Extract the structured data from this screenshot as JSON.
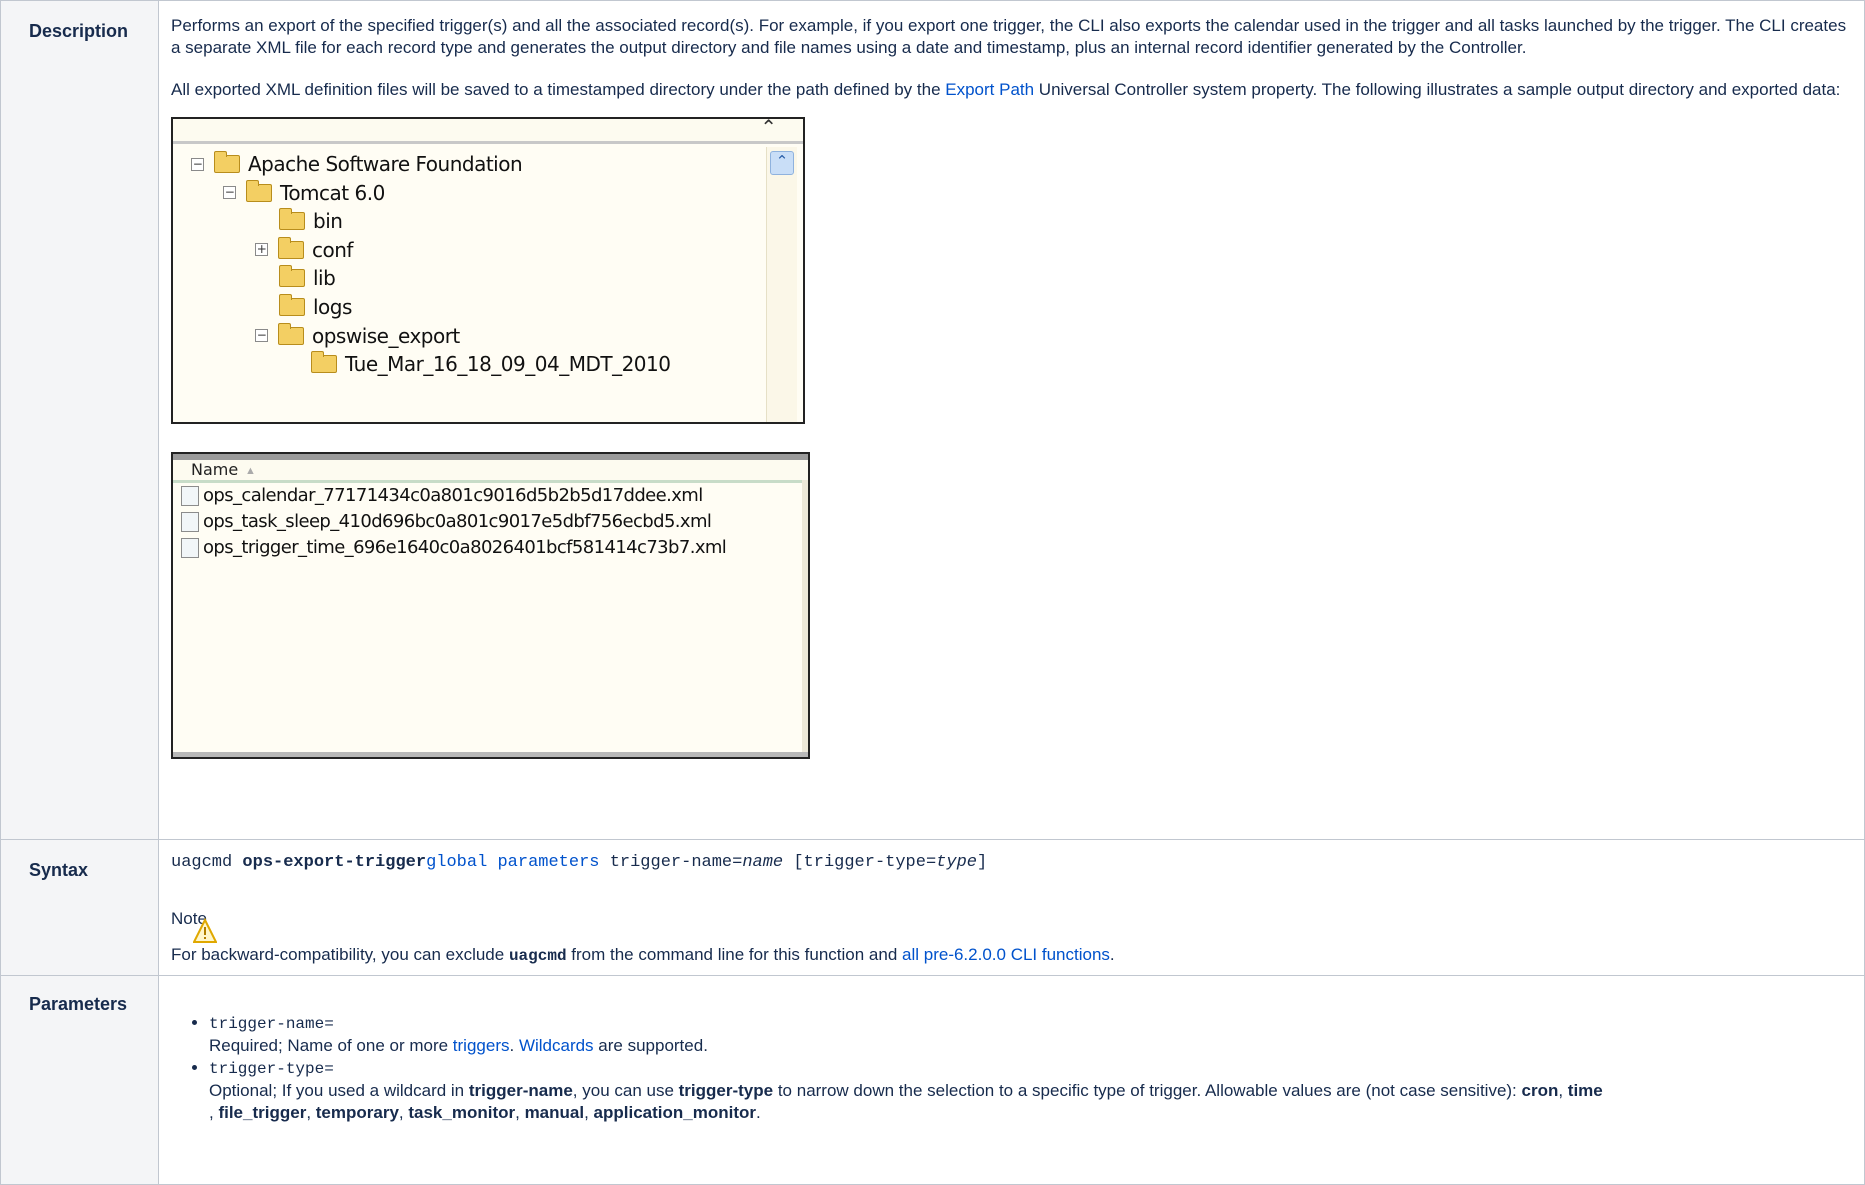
{
  "rows": {
    "description": {
      "label": "Description",
      "para1": "Performs an export of the specified trigger(s) and all the associated record(s). For example, if you export one trigger, the CLI also exports the calendar used in the trigger and all tasks launched by the trigger. The CLI creates a separate XML file for each record type and generates the output directory and file names using a date and timestamp, plus an internal record identifier generated by the Controller.",
      "para2_before": "All exported XML definition files will be saved to a timestamped directory under the path defined by the ",
      "para2_link": "Export Path",
      "para2_after": " Universal Controller system property. The following illustrates a sample output directory and exported data:",
      "tree": [
        {
          "label": "Apache Software Foundation",
          "toggle": "−"
        },
        {
          "label": "Tomcat 6.0",
          "toggle": "−"
        },
        {
          "label": "bin",
          "toggle": ""
        },
        {
          "label": "conf",
          "toggle": "+"
        },
        {
          "label": "lib",
          "toggle": ""
        },
        {
          "label": "logs",
          "toggle": ""
        },
        {
          "label": "opswise_export",
          "toggle": "−"
        },
        {
          "label": "Tue_Mar_16_18_09_04_MDT_2010",
          "toggle": ""
        }
      ],
      "file_header": "Name",
      "files": [
        "ops_calendar_77171434c0a801c9016d5b2b5d17ddee.xml",
        "ops_task_sleep_410d696bc0a801c9017e5dbf756ecbd5.xml",
        "ops_trigger_time_696e1640c0a8026401bcf581414c73b7.xml"
      ]
    },
    "syntax": {
      "label": "Syntax",
      "cmd": "uagcmd ",
      "func": "ops-export-trigger",
      "global_link": "global parameters",
      "arg1": " trigger-name=",
      "arg1_var": "name",
      "arg2": " [trigger-type=",
      "arg2_var": "type",
      "arg2_end": "]",
      "note_title": "Note",
      "note_before": "For backward-compatibility, you can exclude ",
      "note_code": "uagcmd",
      "note_mid": " from the command line for this function and ",
      "note_link": "all pre-6.2.0.0 CLI functions",
      "note_end": "."
    },
    "parameters": {
      "label": "Parameters",
      "p1_name": "trigger-name=",
      "p1_text_before": "Required; Name of one or more ",
      "p1_link1": "triggers",
      "p1_text_mid": ". ",
      "p1_link2": "Wildcards",
      "p1_text_after": " are supported.",
      "p2_name": "trigger-type=",
      "p2_a": "Optional; If you used a wildcard in ",
      "p2_b": "trigger-name",
      "p2_c": ", you can use ",
      "p2_d": "trigger-type",
      "p2_e": " to narrow down the selection to a specific type of trigger. Allowable values are (not case sensitive): ",
      "v_cron": "cron",
      "v_time": "time",
      "v_file": "file_trigger",
      "v_temp": "temporary",
      "v_task": "task_monitor",
      "v_manual": "manual",
      "v_app": "application_monitor"
    }
  }
}
